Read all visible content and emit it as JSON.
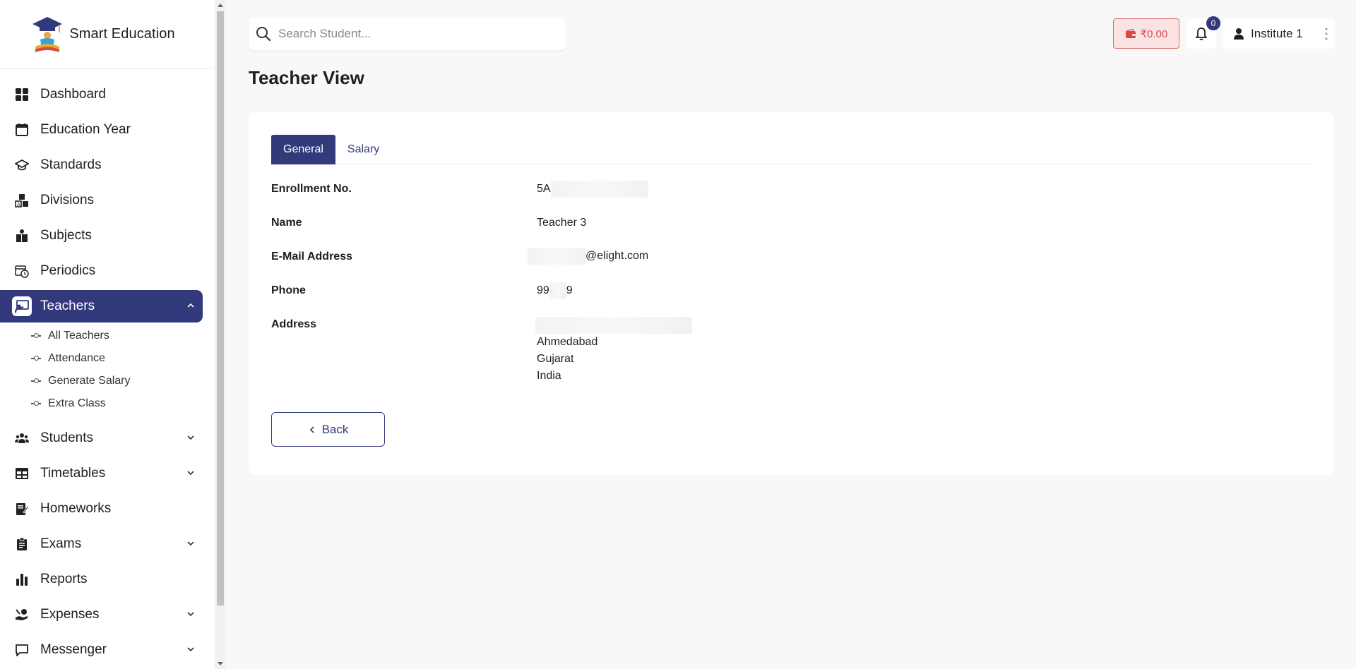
{
  "brand": {
    "name": "Smart Education"
  },
  "sidebar": {
    "items": [
      {
        "label": "Dashboard",
        "icon": "dashboard-icon"
      },
      {
        "label": "Education Year",
        "icon": "calendar-icon"
      },
      {
        "label": "Standards",
        "icon": "graduation-cap-icon"
      },
      {
        "label": "Divisions",
        "icon": "abc-blocks-icon"
      },
      {
        "label": "Subjects",
        "icon": "books-icon"
      },
      {
        "label": "Periodics",
        "icon": "calendar-clock-icon"
      },
      {
        "label": "Teachers",
        "icon": "teacher-board-icon",
        "active": true,
        "expanded": true
      },
      {
        "label": "Students",
        "icon": "users-icon"
      },
      {
        "label": "Timetables",
        "icon": "table-icon"
      },
      {
        "label": "Homeworks",
        "icon": "homework-icon"
      },
      {
        "label": "Exams",
        "icon": "clipboard-icon"
      },
      {
        "label": "Reports",
        "icon": "bar-chart-icon"
      },
      {
        "label": "Expenses",
        "icon": "money-hand-icon"
      },
      {
        "label": "Messenger",
        "icon": "message-icon"
      }
    ],
    "teacher_sub": [
      "All Teachers",
      "Attendance",
      "Generate Salary",
      "Extra Class"
    ]
  },
  "search": {
    "placeholder": "Search Student..."
  },
  "wallet": {
    "amount": "₹0.00",
    "color": "#e04848"
  },
  "notifications": {
    "count": "0"
  },
  "user": {
    "name": "Institute 1"
  },
  "page": {
    "title": "Teacher View"
  },
  "tabs": [
    "General",
    "Salary"
  ],
  "details": {
    "enrollment_label": "Enrollment No.",
    "enrollment_value": "5A",
    "name_label": "Name",
    "name_value": "Teacher 3",
    "email_label": "E-Mail Address",
    "email_value": "@elight.com",
    "phone_label": "Phone",
    "phone_prefix": "99",
    "phone_suffix": "9",
    "address_label": "Address",
    "address_city": "Ahmedabad",
    "address_state": "Gujarat",
    "address_country": "India"
  },
  "back_button": {
    "label": "Back"
  },
  "colors": {
    "primary": "#333a7b",
    "wallet_bg": "#fbe3e3"
  }
}
